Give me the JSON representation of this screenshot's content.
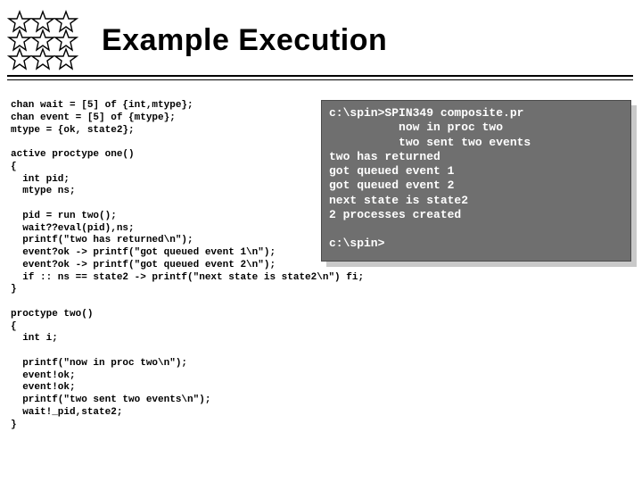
{
  "title": "Example Execution",
  "code": "chan wait = [5] of {int,mtype};\nchan event = [5] of {mtype};\nmtype = {ok, state2};\n\nactive proctype one()\n{\n  int pid;\n  mtype ns;\n\n  pid = run two();\n  wait??eval(pid),ns;\n  printf(\"two has returned\\n\");\n  event?ok -> printf(\"got queued event 1\\n\");\n  event?ok -> printf(\"got queued event 2\\n\");\n  if :: ns == state2 -> printf(\"next state is state2\\n\") fi;\n}\n\nproctype two()\n{\n  int i;\n\n  printf(\"now in proc two\\n\");\n  event!ok;\n  event!ok;\n  printf(\"two sent two events\\n\");\n  wait!_pid,state2;\n}",
  "terminal": "c:\\spin>SPIN349 composite.pr\n          now in proc two\n          two sent two events\ntwo has returned\ngot queued event 1\ngot queued event 2\nnext state is state2\n2 processes created\n\nc:\\spin>"
}
